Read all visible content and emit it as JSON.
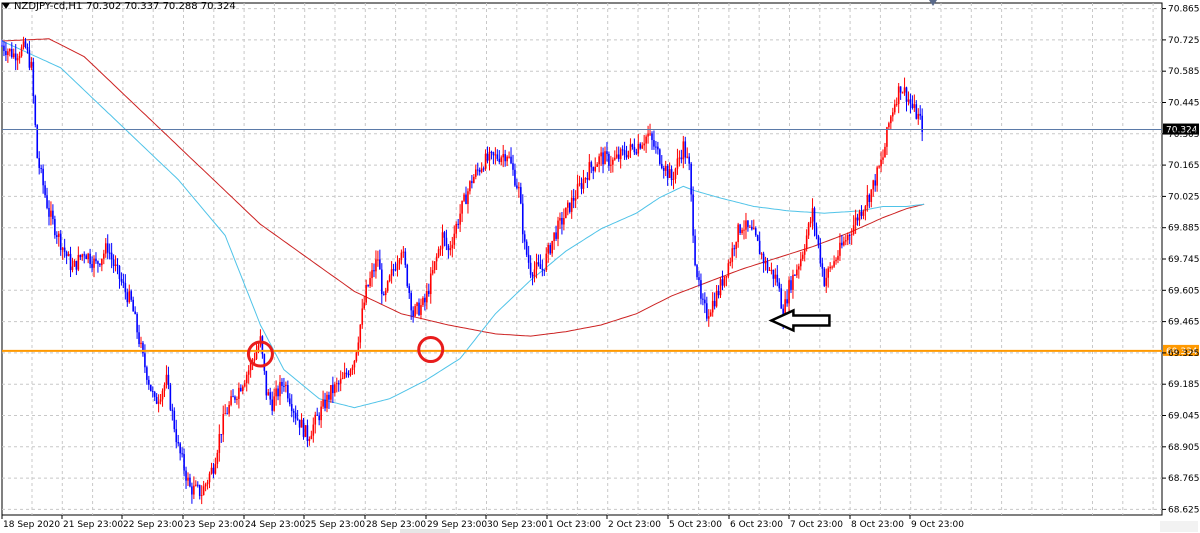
{
  "header": {
    "symbol": "NZDJPY-cd,H1",
    "ohlc": "70.302 70.337 70.288 70.324"
  },
  "colors": {
    "bull": "#ff0000",
    "bear": "#0000ff",
    "ma_fast": "#4fc3e8",
    "ma_slow": "#cc2222",
    "support_line": "#ff9900",
    "current_line": "#5b7aa8",
    "grid": "#c8c8c8",
    "marker_circle": "#e81c1c",
    "arrow": "#000000"
  },
  "chart_data": {
    "type": "candlestick",
    "symbol": "NZDJPY-cd",
    "timeframe": "H1",
    "y_ticks": [
      70.865,
      70.725,
      70.585,
      70.445,
      70.305,
      70.165,
      70.025,
      69.885,
      69.745,
      69.605,
      69.465,
      69.325,
      69.185,
      69.045,
      68.905,
      68.765,
      68.625
    ],
    "ylim": [
      68.6,
      70.89
    ],
    "x_ticks": [
      "18 Sep 2020",
      "21 Sep 23:00",
      "22 Sep 23:00",
      "23 Sep 23:00",
      "24 Sep 23:00",
      "25 Sep 23:00",
      "28 Sep 23:00",
      "29 Sep 23:00",
      "30 Sep 23:00",
      "1 Oct 23:00",
      "2 Oct 23:00",
      "5 Oct 23:00",
      "6 Oct 23:00",
      "7 Oct 23:00",
      "8 Oct 23:00",
      "9 Oct 23:00"
    ],
    "close_path": [
      [
        0,
        70.7
      ],
      [
        2,
        70.66
      ],
      [
        4,
        70.69
      ],
      [
        5,
        70.6
      ],
      [
        6,
        70.2
      ],
      [
        8,
        69.95
      ],
      [
        10,
        69.82
      ],
      [
        12,
        69.7
      ],
      [
        14,
        69.78
      ],
      [
        16,
        69.72
      ],
      [
        18,
        69.8
      ],
      [
        19,
        69.72
      ],
      [
        21,
        69.6
      ],
      [
        22,
        69.55
      ],
      [
        24,
        69.3
      ],
      [
        26,
        69.1
      ],
      [
        28,
        69.2
      ],
      [
        30,
        68.9
      ],
      [
        32,
        68.72
      ],
      [
        34,
        68.7
      ],
      [
        36,
        68.82
      ],
      [
        37,
        68.95
      ],
      [
        38,
        69.05
      ],
      [
        40,
        69.15
      ],
      [
        42,
        69.25
      ],
      [
        44,
        69.38
      ],
      [
        45,
        69.15
      ],
      [
        46,
        69.1
      ],
      [
        48,
        69.2
      ],
      [
        50,
        69.05
      ],
      [
        52,
        68.95
      ],
      [
        54,
        69.05
      ],
      [
        56,
        69.15
      ],
      [
        58,
        69.2
      ],
      [
        60,
        69.3
      ],
      [
        61,
        69.45
      ],
      [
        62,
        69.6
      ],
      [
        64,
        69.75
      ],
      [
        65,
        69.55
      ],
      [
        66,
        69.65
      ],
      [
        68,
        69.8
      ],
      [
        69,
        69.65
      ],
      [
        70,
        69.5
      ],
      [
        72,
        69.55
      ],
      [
        74,
        69.75
      ],
      [
        75,
        69.85
      ],
      [
        76,
        69.78
      ],
      [
        78,
        69.95
      ],
      [
        80,
        70.1
      ],
      [
        82,
        70.18
      ],
      [
        84,
        70.2
      ],
      [
        86,
        70.22
      ],
      [
        88,
        70.05
      ],
      [
        89,
        69.8
      ],
      [
        90,
        69.7
      ],
      [
        92,
        69.7
      ],
      [
        94,
        69.85
      ],
      [
        96,
        69.95
      ],
      [
        98,
        70.05
      ],
      [
        100,
        70.15
      ],
      [
        102,
        70.2
      ],
      [
        104,
        70.18
      ],
      [
        106,
        70.22
      ],
      [
        108,
        70.25
      ],
      [
        110,
        70.3
      ],
      [
        112,
        70.2
      ],
      [
        114,
        70.1
      ],
      [
        116,
        70.25
      ],
      [
        117,
        70.15
      ],
      [
        118,
        69.75
      ],
      [
        119,
        69.55
      ],
      [
        120,
        69.5
      ],
      [
        122,
        69.6
      ],
      [
        124,
        69.75
      ],
      [
        125,
        69.85
      ],
      [
        126,
        69.9
      ],
      [
        128,
        69.85
      ],
      [
        130,
        69.72
      ],
      [
        132,
        69.65
      ],
      [
        133,
        69.5
      ],
      [
        134,
        69.62
      ],
      [
        136,
        69.75
      ],
      [
        137,
        69.85
      ],
      [
        138,
        69.95
      ],
      [
        139,
        69.8
      ],
      [
        140,
        69.65
      ],
      [
        142,
        69.75
      ],
      [
        144,
        69.85
      ],
      [
        146,
        69.95
      ],
      [
        148,
        70.05
      ],
      [
        150,
        70.2
      ],
      [
        151,
        70.35
      ],
      [
        152,
        70.45
      ],
      [
        153,
        70.52
      ],
      [
        154,
        70.48
      ],
      [
        155,
        70.42
      ],
      [
        156,
        70.38
      ],
      [
        157,
        70.32
      ]
    ],
    "ma_fast_path": [
      [
        0,
        70.72
      ],
      [
        10,
        70.6
      ],
      [
        20,
        70.35
      ],
      [
        30,
        70.1
      ],
      [
        38,
        69.85
      ],
      [
        44,
        69.45
      ],
      [
        48,
        69.25
      ],
      [
        54,
        69.12
      ],
      [
        60,
        69.08
      ],
      [
        66,
        69.12
      ],
      [
        72,
        69.2
      ],
      [
        78,
        69.3
      ],
      [
        84,
        69.5
      ],
      [
        90,
        69.65
      ],
      [
        96,
        69.78
      ],
      [
        102,
        69.88
      ],
      [
        108,
        69.95
      ],
      [
        112,
        70.02
      ],
      [
        116,
        70.07
      ],
      [
        118,
        70.05
      ],
      [
        122,
        70.02
      ],
      [
        128,
        69.98
      ],
      [
        134,
        69.96
      ],
      [
        140,
        69.95
      ],
      [
        146,
        69.96
      ],
      [
        150,
        69.98
      ],
      [
        154,
        69.98
      ],
      [
        157,
        69.99
      ]
    ],
    "ma_slow_path": [
      [
        0,
        70.72
      ],
      [
        8,
        70.73
      ],
      [
        14,
        70.65
      ],
      [
        20,
        70.5
      ],
      [
        28,
        70.3
      ],
      [
        36,
        70.1
      ],
      [
        44,
        69.9
      ],
      [
        52,
        69.75
      ],
      [
        60,
        69.6
      ],
      [
        68,
        69.5
      ],
      [
        76,
        69.45
      ],
      [
        84,
        69.41
      ],
      [
        90,
        69.4
      ],
      [
        96,
        69.42
      ],
      [
        102,
        69.45
      ],
      [
        108,
        69.5
      ],
      [
        114,
        69.58
      ],
      [
        120,
        69.64
      ],
      [
        126,
        69.7
      ],
      [
        132,
        69.75
      ],
      [
        138,
        69.8
      ],
      [
        144,
        69.86
      ],
      [
        150,
        69.93
      ],
      [
        154,
        69.97
      ],
      [
        157,
        69.99
      ]
    ],
    "x_range": [
      0,
      158
    ],
    "series": [
      {
        "name": "price",
        "type": "candlestick"
      },
      {
        "type": "line",
        "color": "#4fc3e8"
      },
      {
        "type": "line",
        "color": "#cc2222"
      }
    ],
    "support_level": 69.334,
    "current_price": 70.324,
    "price_labels": {
      "current": "70.324",
      "support": "69.334"
    },
    "annotations": [
      {
        "type": "circle",
        "x": 44,
        "y": 69.32
      },
      {
        "type": "circle",
        "x": 73,
        "y": 69.34
      },
      {
        "type": "arrow",
        "direction": "left",
        "x": 131,
        "y": 69.47
      }
    ],
    "grid": true,
    "legend": "none"
  }
}
